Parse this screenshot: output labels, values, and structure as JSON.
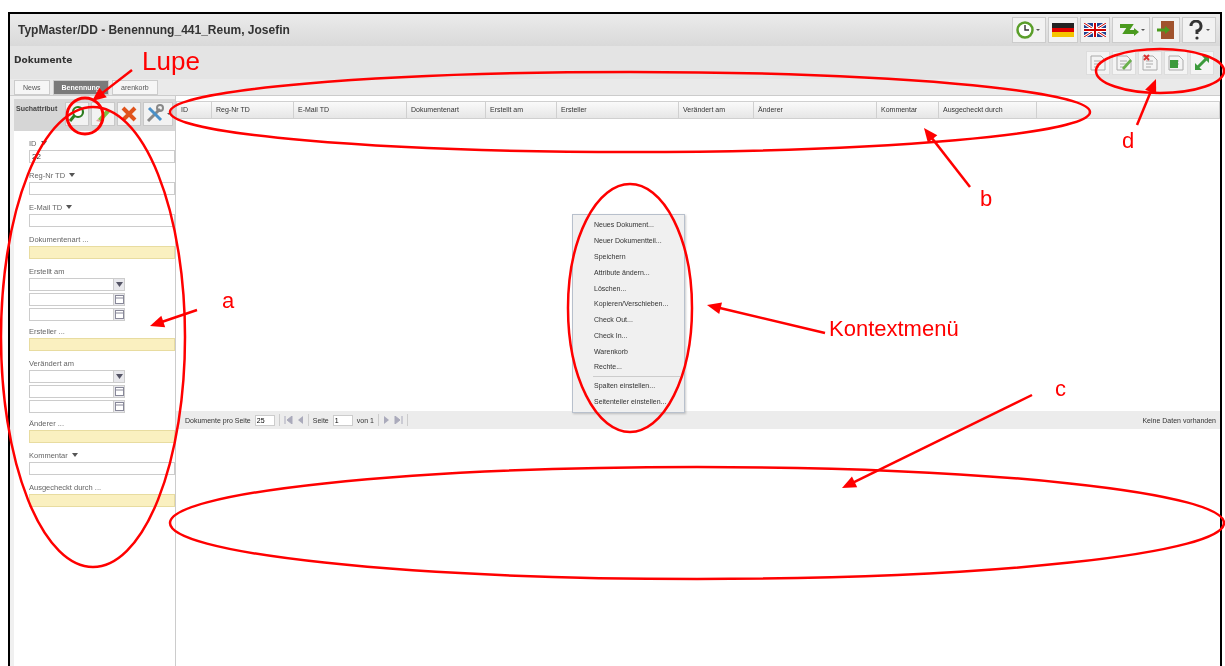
{
  "window": {
    "title": "TypMaster/DD - Benennung_441_Reum, Josefin"
  },
  "header": {
    "title": "Dokumente"
  },
  "tabs": [
    {
      "label": "News",
      "selected": false
    },
    {
      "label": "Benennung",
      "selected": true
    },
    {
      "label": "arenkorb",
      "selected": false
    }
  ],
  "search_panel": {
    "title": "Suchattribut",
    "fields": [
      {
        "label": "ID",
        "kind": "text",
        "value": "22"
      },
      {
        "label": "Reg-Nr TD",
        "kind": "text"
      },
      {
        "label": "E-Mail TD",
        "kind": "text"
      },
      {
        "label": "Dokumentenart ...",
        "kind": "lookup"
      },
      {
        "label": "Erstellt am",
        "kind": "date_range"
      },
      {
        "label": "Ersteller ...",
        "kind": "lookup"
      },
      {
        "label": "Verändert am",
        "kind": "date_range"
      },
      {
        "label": "Änderer ...",
        "kind": "lookup"
      },
      {
        "label": "Kommentar",
        "kind": "text"
      },
      {
        "label": "Ausgecheckt durch ...",
        "kind": "lookup"
      }
    ]
  },
  "table": {
    "columns": [
      "ID",
      "Reg-Nr TD",
      "E-Mail TD",
      "Dokumentenart",
      "Erstellt am",
      "Ersteller",
      "Verändert am",
      "Änderer",
      "Kommentar",
      "Ausgecheckt durch"
    ]
  },
  "context_menu": {
    "groups": [
      [
        "Neues Dokument...",
        "Neuer Dokumentteil...",
        "Speichern",
        "Attribute ändern...",
        "Löschen...",
        "Kopieren/Verschieben...",
        "Check Out...",
        "Check In...",
        "Warenkorb",
        "Rechte..."
      ],
      [
        "Spalten einstellen...",
        "Seitenteiler einstellen..."
      ]
    ]
  },
  "paging": {
    "page_size_label": "Dokumente pro Seite",
    "page_size": "25",
    "page_label": "Seite",
    "page": "1",
    "of_label": "von 1",
    "status": "Keine Daten vorhanden"
  },
  "annotations": [
    {
      "label": "Lupe"
    },
    {
      "label": "a"
    },
    {
      "label": "b"
    },
    {
      "label": "Kontextmenü"
    },
    {
      "label": "c"
    },
    {
      "label": "d"
    }
  ]
}
